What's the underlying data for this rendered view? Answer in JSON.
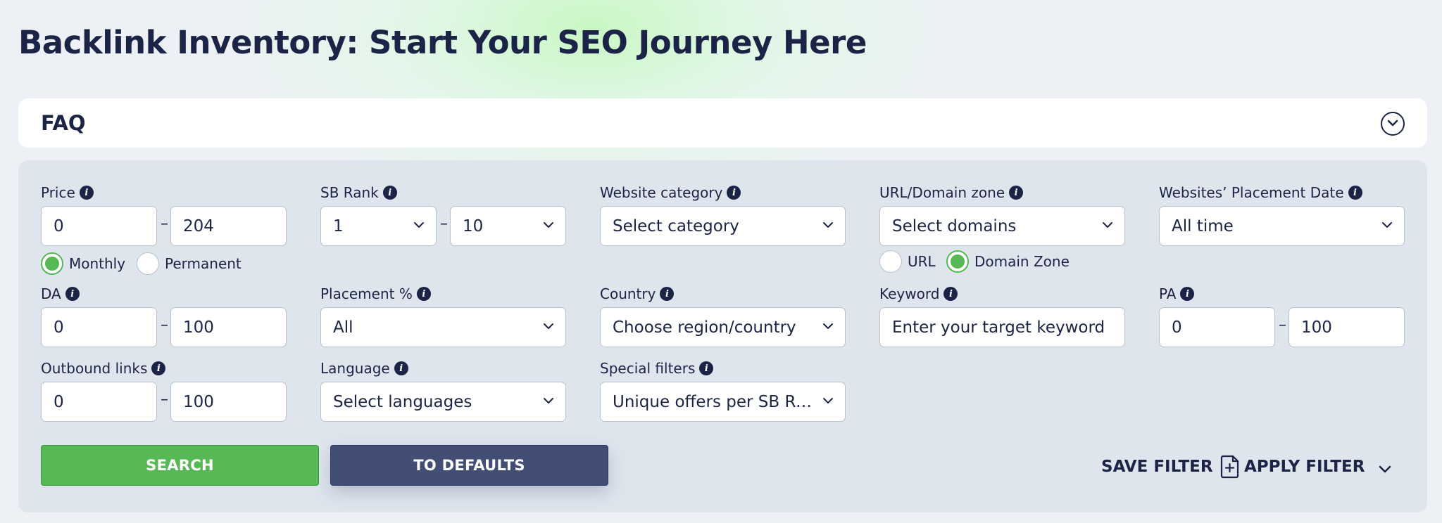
{
  "page": {
    "title": "Backlink Inventory: Start Your SEO Journey Here"
  },
  "faq": {
    "title": "FAQ",
    "toggle_icon": "chevron-down-circle-icon"
  },
  "filters": {
    "price": {
      "label": "Price",
      "min": "0",
      "max": "204",
      "radio": {
        "monthly": "Monthly",
        "permanent": "Permanent",
        "selected": "Monthly"
      }
    },
    "sb_rank": {
      "label": "SB Rank",
      "min": "1",
      "max": "10"
    },
    "website_category": {
      "label": "Website category",
      "placeholder": "Select category"
    },
    "url_domain_zone": {
      "label": "URL/Domain zone",
      "placeholder": "Select domains",
      "radio": {
        "url": "URL",
        "domain_zone": "Domain Zone",
        "selected": "Domain Zone"
      }
    },
    "placement_date": {
      "label": "Websites’ Placement Date",
      "value": "All time"
    },
    "da": {
      "label": "DA",
      "min": "0",
      "max": "100"
    },
    "placement_pct": {
      "label": "Placement %",
      "value": "All"
    },
    "country": {
      "label": "Country",
      "placeholder": "Choose region/country"
    },
    "keyword": {
      "label": "Keyword",
      "placeholder": "Enter your target keyword"
    },
    "pa": {
      "label": "PA",
      "min": "0",
      "max": "100"
    },
    "outbound_links": {
      "label": "Outbound links",
      "min": "0",
      "max": "100"
    },
    "language": {
      "label": "Language",
      "placeholder": "Select languages"
    },
    "special_filters": {
      "label": "Special filters",
      "value": "Unique offers per SB Rank"
    }
  },
  "actions": {
    "search": "SEARCH",
    "defaults": "TO DEFAULTS",
    "save_filter": "SAVE FILTER",
    "apply_filter": "APPLY FILTER"
  },
  "colors": {
    "accent_green": "#57b956",
    "navy": "#1b2446",
    "button_slate": "#434e74"
  },
  "dash": "–"
}
